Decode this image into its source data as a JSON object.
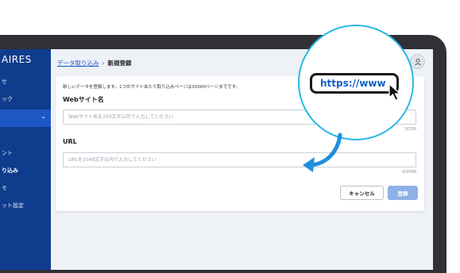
{
  "sidebar": {
    "brand": "AIRES",
    "items": [
      {
        "label": "せ"
      },
      {
        "label": "ック"
      },
      {
        "label": "ント"
      },
      {
        "label": "り込み"
      },
      {
        "label": "モ"
      },
      {
        "label": "ット設定"
      }
    ],
    "group_chevron": "⌄"
  },
  "breadcrumb": {
    "parent": "データ取り込み",
    "separator": "›",
    "current": "新規登録"
  },
  "form": {
    "description": "新しいデータを登録します。1つのサイトあたり取り込みページは10000ページまでです。",
    "site_name_label": "Webサイト名",
    "site_name_placeholder": "Webサイト名を200文字以内で入力してください",
    "site_name_counter": "0/200",
    "url_label": "URL",
    "url_placeholder": "URLを2048文字以内で入力してください",
    "url_counter": "0/2048",
    "cancel_label": "キャンセル",
    "register_label": "登録"
  },
  "zoom": {
    "url_text": "https://www"
  },
  "colors": {
    "sidebar": "#0f3c8c",
    "accent": "#1a56c7",
    "zoom_ring": "#29b6e8",
    "arrow": "#1e8fdc",
    "register_disabled": "#8fb0e6"
  }
}
